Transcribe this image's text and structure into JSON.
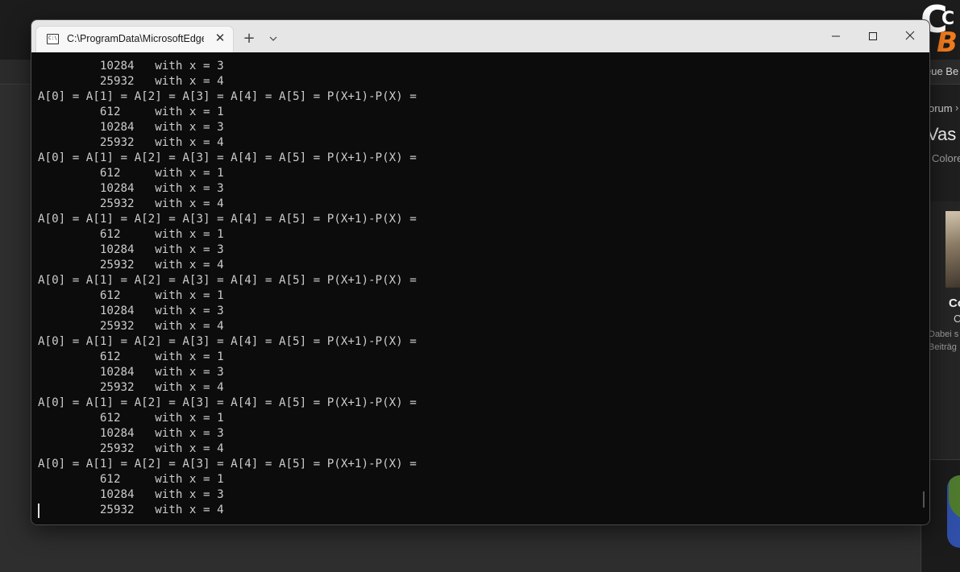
{
  "terminal": {
    "tab_title": "C:\\ProgramData\\MicrosoftEdge",
    "tab_icon_text": "C:\\",
    "close_tab_glyph": "✕",
    "new_tab_glyph": "+",
    "dropdown_glyph": "⌄",
    "minimize_glyph": "—",
    "maximize_glyph": "☐",
    "close_glyph": "✕",
    "lines": [
      "         10284   with x = 3",
      "         25932   with x = 4",
      "A[0] = A[1] = A[2] = A[3] = A[4] = A[5] = P(X+1)-P(X) =",
      "         612     with x = 1",
      "         10284   with x = 3",
      "         25932   with x = 4",
      "A[0] = A[1] = A[2] = A[3] = A[4] = A[5] = P(X+1)-P(X) =",
      "         612     with x = 1",
      "         10284   with x = 3",
      "         25932   with x = 4",
      "A[0] = A[1] = A[2] = A[3] = A[4] = A[5] = P(X+1)-P(X) =",
      "         612     with x = 1",
      "         10284   with x = 3",
      "         25932   with x = 4",
      "A[0] = A[1] = A[2] = A[3] = A[4] = A[5] = P(X+1)-P(X) =",
      "         612     with x = 1",
      "         10284   with x = 3",
      "         25932   with x = 4",
      "A[0] = A[1] = A[2] = A[3] = A[4] = A[5] = P(X+1)-P(X) =",
      "         612     with x = 1",
      "         10284   with x = 3",
      "         25932   with x = 4",
      "A[0] = A[1] = A[2] = A[3] = A[4] = A[5] = P(X+1)-P(X) =",
      "         612     with x = 1",
      "         10284   with x = 3",
      "         25932   with x = 4",
      "A[0] = A[1] = A[2] = A[3] = A[4] = A[5] = P(X+1)-P(X) =",
      "         612     with x = 1",
      "         10284   with x = 3",
      "         25932   with x = 4"
    ]
  },
  "background": {
    "tab_text": "eue Be",
    "breadcrumb": "orum",
    "breadcrumb_sep": "›",
    "heading": "Vas",
    "sub": "Colore",
    "card_title": "Co",
    "card_sub": "C",
    "card_text_1": "Dabei s",
    "card_text_2": "Beiträg"
  },
  "colors": {
    "console_bg": "#0c0c0c",
    "console_fg": "#cccccc",
    "titlebar_bg": "#e6e6e6",
    "page_bg": "#2e2e2e",
    "logo_orange": "#f07c1e"
  }
}
